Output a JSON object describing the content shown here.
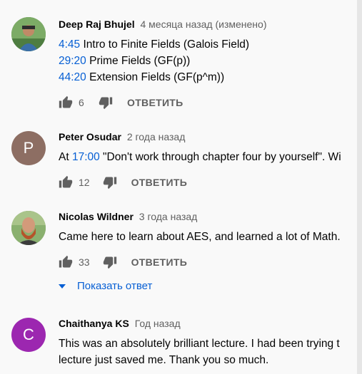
{
  "comments": [
    {
      "author": "Deep Raj Bhujel",
      "meta": "4 месяца назад (изменено)",
      "avatar": {
        "type": "photo",
        "bg": "#6a9a5b"
      },
      "lines": [
        {
          "ts": "4:45",
          "text": " Intro to Finite Fields (Galois Field)"
        },
        {
          "ts": "29:20",
          "text": " Prime Fields (GF(p))"
        },
        {
          "ts": "44:20",
          "text": " Extension Fields (GF(p^m))"
        }
      ],
      "likes": "6",
      "reply_label": "ОТВЕТИТЬ"
    },
    {
      "author": "Peter Osudar",
      "meta": "2 года назад",
      "avatar": {
        "type": "letter",
        "letter": "P",
        "bg": "#8d6e63"
      },
      "lines": [
        {
          "pre": "At ",
          "ts": "17:00",
          "text": " \"Don't work through chapter four by yourself\". Wi"
        }
      ],
      "likes": "12",
      "reply_label": "ОТВЕТИТЬ"
    },
    {
      "author": "Nicolas Wildner",
      "meta": "3 года назад",
      "avatar": {
        "type": "photo",
        "bg": "#7fa36a"
      },
      "lines": [
        {
          "text": "Came here to learn about AES, and learned a lot of Math."
        }
      ],
      "likes": "33",
      "reply_label": "ОТВЕТИТЬ",
      "show_replies": "Показать ответ"
    },
    {
      "author": "Chaithanya KS",
      "meta": "Год назад",
      "avatar": {
        "type": "letter",
        "letter": "C",
        "bg": "#9c27b0"
      },
      "lines": [
        {
          "text": "This was an absolutely brilliant lecture. I had been trying t"
        },
        {
          "text": "lecture just saved me. Thank you so much."
        }
      ]
    }
  ],
  "colors": {
    "link": "#065fd4",
    "meta": "#606060",
    "background": "#f9f9f9"
  },
  "icons": {
    "like": "thumb-up-icon",
    "dislike": "thumb-down-icon",
    "expand": "triangle-down-icon"
  }
}
